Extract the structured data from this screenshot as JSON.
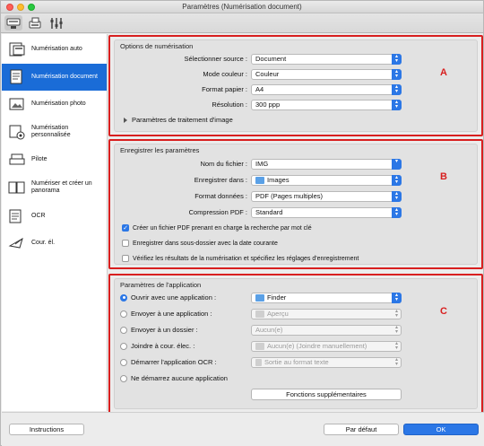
{
  "window": {
    "title": "Paramètres (Numérisation document)"
  },
  "toolbar": {
    "tabs": [
      {
        "icon": "scan-from-computer-icon"
      },
      {
        "icon": "scan-from-operation-panel-icon"
      },
      {
        "icon": "general-settings-icon"
      }
    ]
  },
  "sidebar": {
    "items": [
      {
        "label": "Numérisation auto",
        "icon": "auto-scan-icon",
        "selected": false
      },
      {
        "label": "Numérisation document",
        "icon": "document-scan-icon",
        "selected": true
      },
      {
        "label": "Numérisation photo",
        "icon": "photo-scan-icon",
        "selected": false
      },
      {
        "label": "Numérisation personnalisée",
        "icon": "custom-scan-icon",
        "selected": false
      },
      {
        "label": "Pilote",
        "icon": "driver-icon",
        "selected": false
      },
      {
        "label": "Numériser et créer un panorama",
        "icon": "panorama-icon",
        "selected": false
      },
      {
        "label": "OCR",
        "icon": "ocr-icon",
        "selected": false
      },
      {
        "label": "Cour. él.",
        "icon": "email-icon",
        "selected": false
      }
    ]
  },
  "scan_options": {
    "title": "Options de numérisation",
    "letter": "A",
    "source_label": "Sélectionner source :",
    "source_value": "Document",
    "color_label": "Mode couleur :",
    "color_value": "Couleur",
    "paper_label": "Format papier :",
    "paper_value": "A4",
    "resolution_label": "Résolution :",
    "resolution_value": "300 ppp",
    "image_processing_label": "Paramètres de traitement d'image"
  },
  "save_settings": {
    "title": "Enregistrer les paramètres",
    "letter": "B",
    "filename_label": "Nom du fichier :",
    "filename_value": "IMG",
    "save_in_label": "Enregistrer dans :",
    "save_in_value": "Images",
    "format_label": "Format données :",
    "format_value": "PDF (Pages multiples)",
    "compression_label": "Compression PDF :",
    "compression_value": "Standard",
    "check_searchable": "Créer un fichier PDF prenant en charge la recherche par mot clé",
    "check_searchable_checked": true,
    "check_subfolder": "Enregistrer dans sous-dossier avec la date courante",
    "check_subfolder_checked": false,
    "check_verify": "Vérifiez les résultats de la numérisation et spécifiez les réglages d'enregistrement",
    "check_verify_checked": false
  },
  "app_settings": {
    "title": "Paramètres de l'application",
    "letter": "C",
    "open_app_label": "Ouvrir avec une application :",
    "open_app_value": "Finder",
    "send_app_label": "Envoyer à une application :",
    "send_app_value": "Aperçu",
    "send_folder_label": "Envoyer à un dossier :",
    "send_folder_value": "Aucun(e)",
    "attach_email_label": "Joindre à cour. élec. :",
    "attach_email_value": "Aucun(e) (Joindre manuellement)",
    "start_ocr_label": "Démarrer l'application OCR :",
    "start_ocr_value": "Sortie au format texte",
    "no_app_label": "Ne démarrez aucune application",
    "more_functions_label": "Fonctions supplémentaires"
  },
  "footer": {
    "instructions_label": "Instructions",
    "defaults_label": "Par défaut",
    "ok_label": "OK"
  },
  "colors": {
    "accent": "#2b77e6",
    "highlight_border": "#d81f1f",
    "sidebar_selected": "#1a6cd7"
  }
}
